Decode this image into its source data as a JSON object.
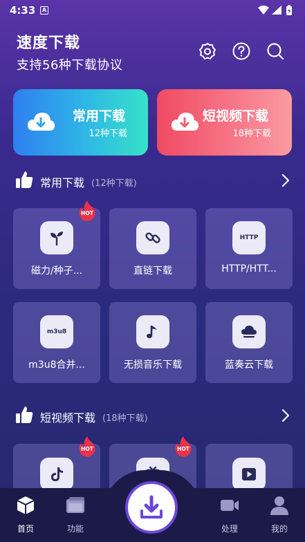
{
  "status_bar": {
    "time": "4:33",
    "notification_glyph": "A"
  },
  "header": {
    "title": "速度下载",
    "subtitle": "支持56种下载协议",
    "icons": [
      "settings-icon",
      "help-icon",
      "search-icon"
    ]
  },
  "top_cards": [
    {
      "title": "常用下载",
      "count": "12种下载",
      "color_from": "#2f7ff0",
      "color_to": "#36e2c7"
    },
    {
      "title": "短视频下载",
      "count": "18种下载",
      "color_from": "#f04a63",
      "color_to": "#fb9aa0"
    }
  ],
  "section_common": {
    "title": "常用下载",
    "count": "(12种下载)",
    "tiles": [
      {
        "label": "磁力/种子...",
        "icon": "sprout-icon",
        "hot": true,
        "hot_label": "HOT"
      },
      {
        "label": "直链下载",
        "icon": "link-icon",
        "hot": false
      },
      {
        "label": "HTTP/HTT...",
        "icon": "http-icon",
        "icon_text": "HTTP",
        "hot": false
      },
      {
        "label": "m3u8合并...",
        "icon": "m3u8-icon",
        "icon_text": "m3u8",
        "hot": false
      },
      {
        "label": "无损音乐下载",
        "icon": "music-note-icon",
        "hot": false
      },
      {
        "label": "蓝奏云下载",
        "icon": "cloud-icon",
        "hot": false
      }
    ]
  },
  "section_short": {
    "title": "短视频下载",
    "count": "(18种下载)",
    "tiles": [
      {
        "label": "",
        "icon": "tiktok-icon",
        "hot": true,
        "hot_label": "HOT"
      },
      {
        "label": "",
        "icon": "tv-icon",
        "hot": true,
        "hot_label": "HOT"
      },
      {
        "label": "",
        "icon": "play-icon",
        "hot": false
      }
    ]
  },
  "bottom_nav": {
    "items": [
      {
        "label": "首页",
        "icon": "home-cube-icon",
        "active": true
      },
      {
        "label": "功能",
        "icon": "folder-icon",
        "active": false
      },
      {
        "label": "处理",
        "icon": "video-camera-icon",
        "active": false
      },
      {
        "label": "我的",
        "icon": "profile-icon",
        "active": false
      }
    ],
    "center": "download-icon"
  },
  "colors": {
    "accent": "#6a48d8",
    "hot": "#e8334a",
    "tile_bg": "#6b63b8"
  }
}
